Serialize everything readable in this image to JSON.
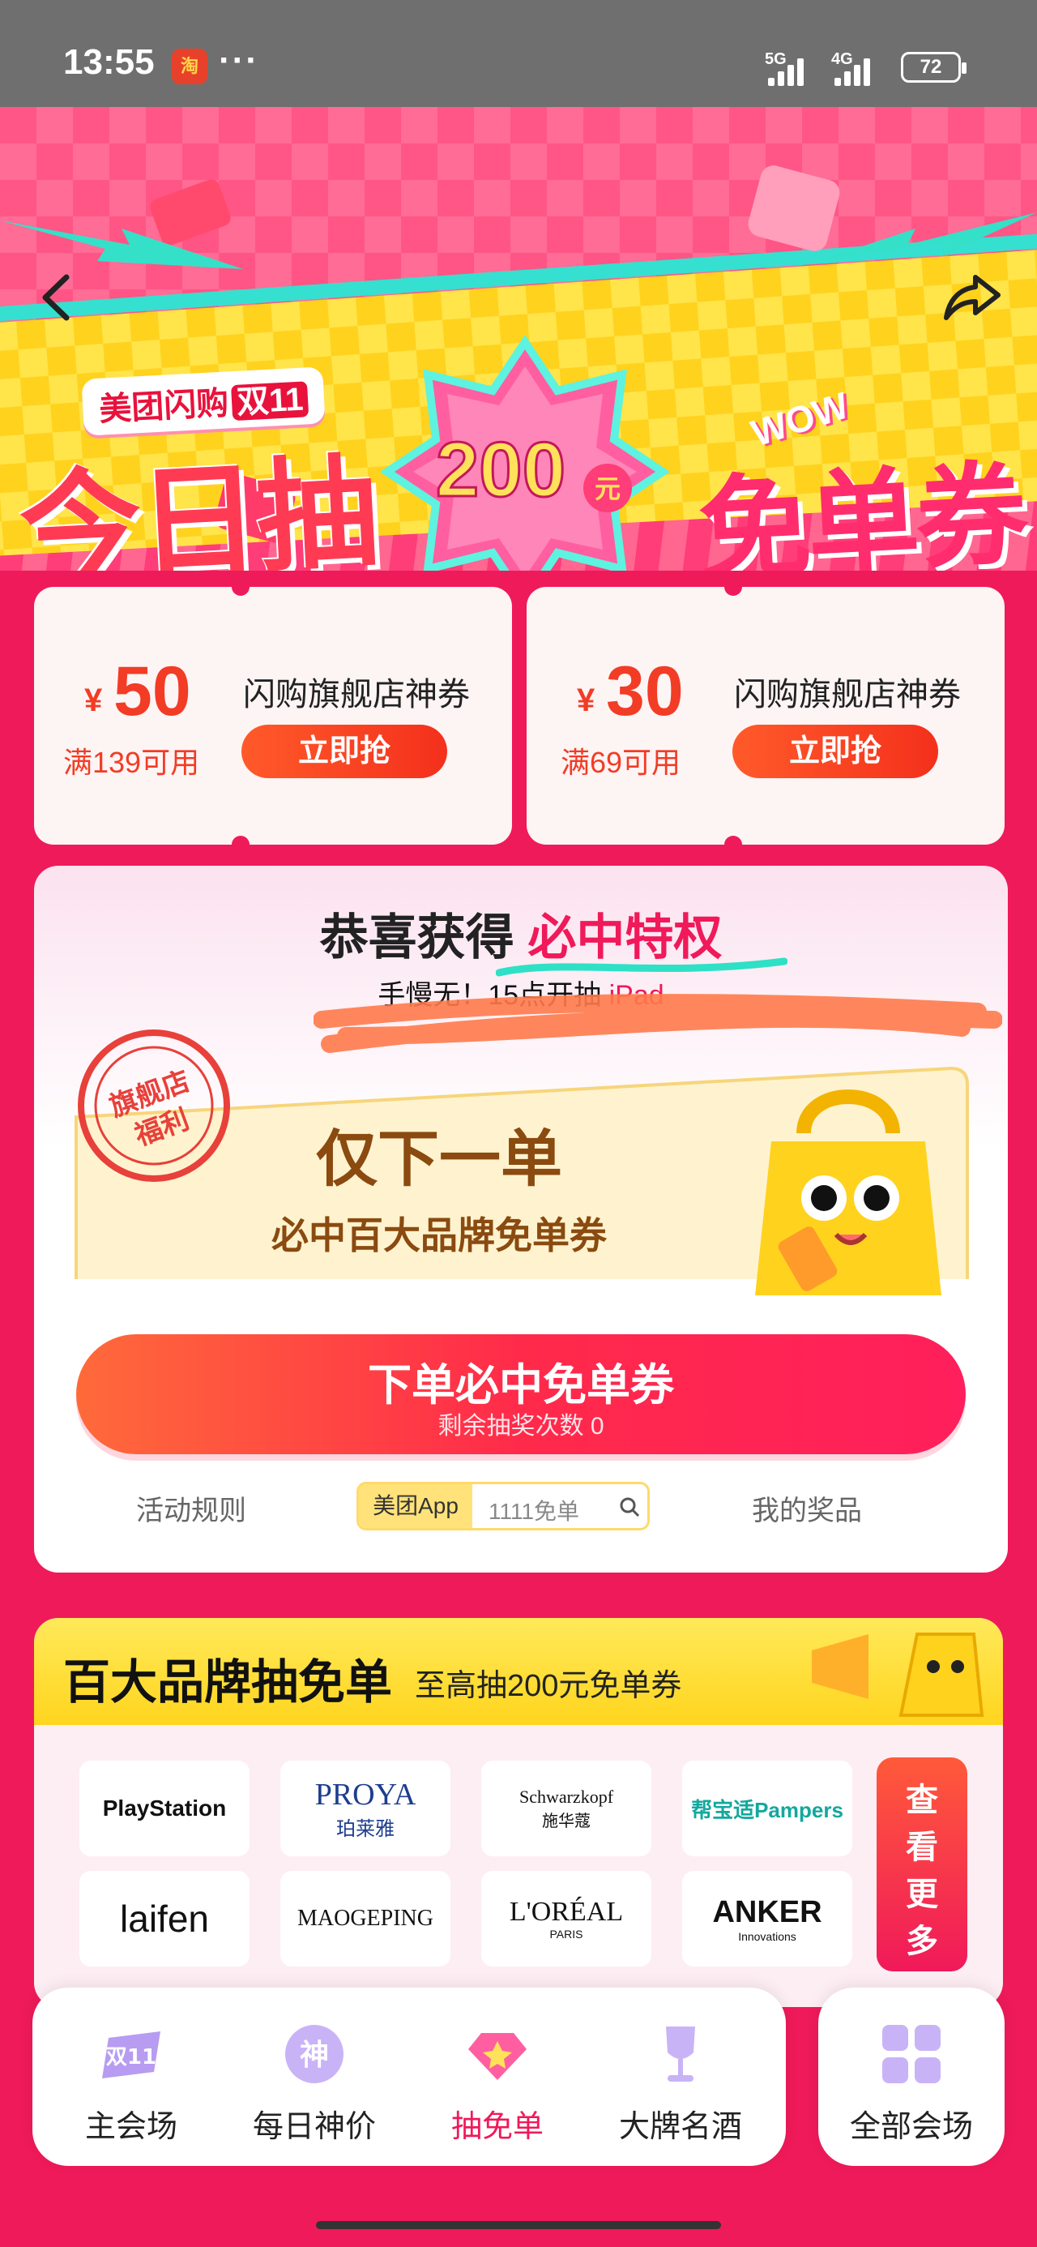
{
  "status_bar": {
    "time": "13:55",
    "app_badge": "淘",
    "more": "···",
    "net1": "5G",
    "net2": "4G",
    "battery": "72"
  },
  "banner": {
    "brand_tag": "美团闪购",
    "brand_tag_accent": "双11",
    "headline_left": "今日抽",
    "badge_amount": "200",
    "badge_unit": "元",
    "headline_right": "免单券",
    "wow": "WOW"
  },
  "coupons": [
    {
      "symbol": "¥",
      "amount": "50",
      "condition": "满139可用",
      "name": "闪购旗舰店神券",
      "button": "立即抢"
    },
    {
      "symbol": "¥",
      "amount": "30",
      "condition": "满69可用",
      "name": "闪购旗舰店神券",
      "button": "立即抢"
    }
  ],
  "privilege": {
    "title_prefix": "恭喜获得",
    "title_highlight": "必中特权",
    "sub_prefix": "手慢无！15点开抽",
    "sub_highlight": "iPad",
    "seal_line1": "旗舰店",
    "seal_line2": "福利",
    "ticket_main": "仅下一单",
    "ticket_sub": "必中百大品牌免单券",
    "draw_button": "下单必中免单券",
    "draw_remaining": "剩余抽奖次数 0",
    "rules_link": "活动规则",
    "search_tag": "美团App",
    "search_text": "1111免单",
    "prizes_link": "我的奖品"
  },
  "brands": {
    "title": "百大品牌抽免单",
    "subtitle": "至高抽200元免单券",
    "logos": [
      {
        "name": "PlayStation"
      },
      {
        "name": "PROYA",
        "sub": "珀莱雅"
      },
      {
        "name": "Schwarzkopf",
        "sub": "施华蔻"
      },
      {
        "name": "帮宝适Pampers"
      },
      {
        "name": "laifen"
      },
      {
        "name": "MAOGEPING"
      },
      {
        "name": "L'ORÉAL",
        "sub": "PARIS"
      },
      {
        "name": "ANKER",
        "sub": "Innovations"
      }
    ],
    "more": [
      "查",
      "看",
      "更",
      "多"
    ]
  },
  "nav": {
    "items": [
      {
        "label": "主会场",
        "icon": "double11-icon"
      },
      {
        "label": "每日神价",
        "icon": "shen-icon",
        "icon_text": "神"
      },
      {
        "label": "抽免单",
        "icon": "diamond-icon",
        "active": true
      },
      {
        "label": "大牌名酒",
        "icon": "wine-glass-icon"
      }
    ],
    "all": {
      "label": "全部会场",
      "icon": "grid-icon"
    }
  },
  "colors": {
    "accent": "#f0195a",
    "coupon_red": "#f23c25",
    "bg": "#ef1a5a",
    "yellow": "#ffd51e"
  }
}
